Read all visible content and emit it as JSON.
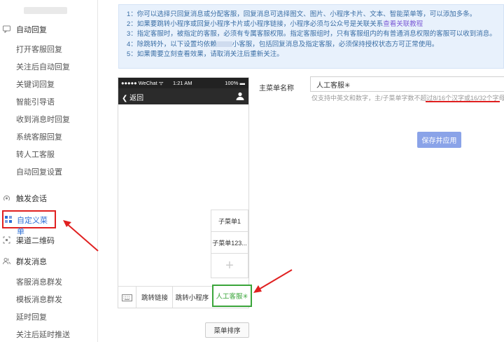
{
  "sidebar": {
    "groups": [
      {
        "label": "自动回复",
        "icon": "message-icon"
      },
      {
        "label": "触发会话",
        "icon": "broadcast-icon"
      },
      {
        "label": "自定义菜单",
        "icon": "menu-grid-icon"
      },
      {
        "label": "渠道二维码",
        "icon": "qrcode-icon"
      },
      {
        "label": "群发消息",
        "icon": "users-icon"
      }
    ],
    "auto_reply_items": [
      "打开客服回复",
      "关注后自动回复",
      "关键词回复",
      "智能引导语",
      "收到消息时回复",
      "系统客服回复",
      "转人工客服",
      "自动回复设置"
    ],
    "broadcast_items": [
      "客服消息群发",
      "模板消息群发",
      "延时回复",
      "关注后延时推送"
    ]
  },
  "info": {
    "lines": [
      "1：你可以选择只回复消息或分配客服，回复消息可选择图文、图片、小程序卡片、文本、智能菜单等，可以添加多条。",
      "2：如果要跳转小程序或回复小程序卡片或小程序链接，小程序必须与公众号是关联关系",
      "3：指定客服时，被指定的客服，必须有专属客服权限。指定客服组时，只有客服组内的有普通消息权限的客服可以收到消息。",
      "4：除跳转外，以下设置均依赖",
      "5：如果需要立刻查看效果，请取消关注后重新关注。"
    ],
    "line2_link": "查看关联教程",
    "line4_rest": "小客服，包括回复消息及指定客服，必须保持授权状态方可正常使用。"
  },
  "phone": {
    "carrier": "●●●●● WeChat ᯤ",
    "time": "1:21 AM",
    "battery": "100% ▬",
    "back_label": "返回",
    "submenus": [
      "子菜单1",
      "子菜单123...",
      "+"
    ],
    "menus": [
      "跳转链接",
      "跳转小程序",
      "人工客服✳"
    ],
    "sort_label": "菜单排序"
  },
  "form": {
    "label": "主菜单名称",
    "value": "人工客服✳",
    "hint": "仅支持中英文和数字，主/子菜单字数不超过8/16个汉字或16/32个字母",
    "save_label": "保存并应用"
  },
  "colors": {
    "accent": "#2e6fd6",
    "highlight": "#e02020",
    "selected": "#3aa53a",
    "save": "#8aa3e8"
  }
}
